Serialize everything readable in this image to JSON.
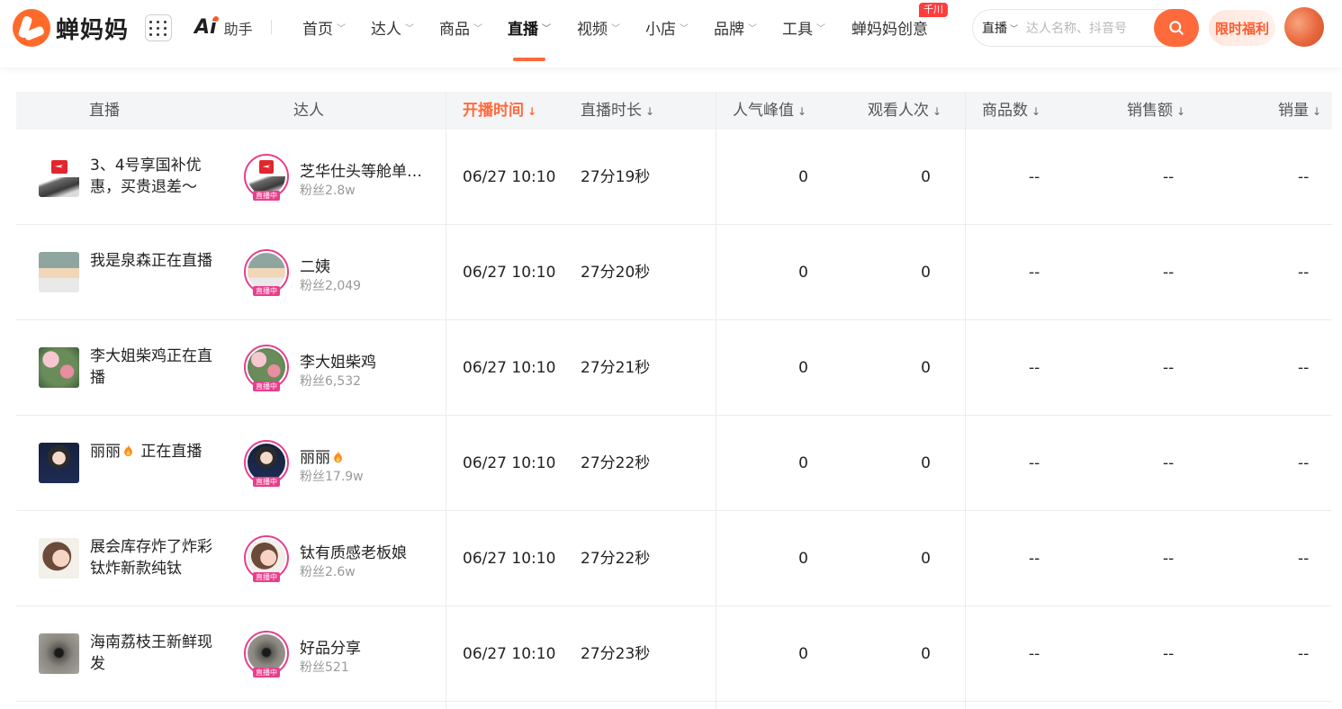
{
  "brand": {
    "name": "蝉妈妈"
  },
  "ai": {
    "logo": "Ai",
    "label": "助手"
  },
  "nav": {
    "items": [
      {
        "label": "首页",
        "chevron": true,
        "active": false
      },
      {
        "label": "达人",
        "chevron": true,
        "active": false
      },
      {
        "label": "商品",
        "chevron": true,
        "active": false
      },
      {
        "label": "直播",
        "chevron": true,
        "active": true
      },
      {
        "label": "视频",
        "chevron": true,
        "active": false
      },
      {
        "label": "小店",
        "chevron": true,
        "active": false
      },
      {
        "label": "品牌",
        "chevron": true,
        "active": false
      },
      {
        "label": "工具",
        "chevron": true,
        "active": false
      },
      {
        "label": "蝉妈妈创意",
        "chevron": false,
        "active": false,
        "badge": "千川"
      }
    ]
  },
  "search": {
    "type": "直播",
    "placeholder": "达人名称、抖音号"
  },
  "promo": {
    "label": "限时福利"
  },
  "accent_color": "#ff6a3c",
  "live_ring_color": "#e83e8c",
  "table": {
    "headers": {
      "live": "直播",
      "creator": "达人",
      "start_time": "开播时间",
      "duration": "直播时长",
      "peak": "人气峰值",
      "views": "观看人次",
      "products": "商品数",
      "sales_amount": "销售额",
      "sales_volume": "销量"
    },
    "live_tag": "直播中",
    "rows": [
      {
        "title": "3、4号享国补优惠，买贵退差～",
        "creator": "芝华仕头等舱单…",
        "fans": "粉丝2.8w",
        "start_time": "06/27 10:10",
        "duration": "27分19秒",
        "peak": "0",
        "views": "0",
        "products": "--",
        "sales_amount": "--",
        "sales_volume": "--",
        "thumb": "plane"
      },
      {
        "title": "我是泉森正在直播",
        "creator": "二姨",
        "fans": "粉丝2,049",
        "start_time": "06/27 10:10",
        "duration": "27分20秒",
        "peak": "0",
        "views": "0",
        "products": "--",
        "sales_amount": "--",
        "sales_volume": "--",
        "thumb": "kids"
      },
      {
        "title": "李大姐柴鸡正在直播",
        "creator": "李大姐柴鸡",
        "fans": "粉丝6,532",
        "start_time": "06/27 10:10",
        "duration": "27分21秒",
        "peak": "0",
        "views": "0",
        "products": "--",
        "sales_amount": "--",
        "sales_volume": "--",
        "thumb": "flowers"
      },
      {
        "title_prefix": "丽丽",
        "title_suffix": " 正在直播",
        "fire_title": true,
        "creator": "丽丽",
        "fire_creator": true,
        "fans": "粉丝17.9w",
        "start_time": "06/27 10:10",
        "duration": "27分22秒",
        "peak": "0",
        "views": "0",
        "products": "--",
        "sales_amount": "--",
        "sales_volume": "--",
        "thumb": "woman1"
      },
      {
        "title": "展会库存炸了炸彩钛炸新款纯钛",
        "creator": "钛有质感老板娘",
        "fans": "粉丝2.6w",
        "start_time": "06/27 10:10",
        "duration": "27分22秒",
        "peak": "0",
        "views": "0",
        "products": "--",
        "sales_amount": "--",
        "sales_volume": "--",
        "thumb": "woman2"
      },
      {
        "title": "海南荔枝王新鲜现发",
        "creator": "好品分享",
        "fans": "粉丝521",
        "start_time": "06/27 10:10",
        "duration": "27分23秒",
        "peak": "0",
        "views": "0",
        "products": "--",
        "sales_amount": "--",
        "sales_volume": "--",
        "thumb": "hole"
      }
    ]
  }
}
